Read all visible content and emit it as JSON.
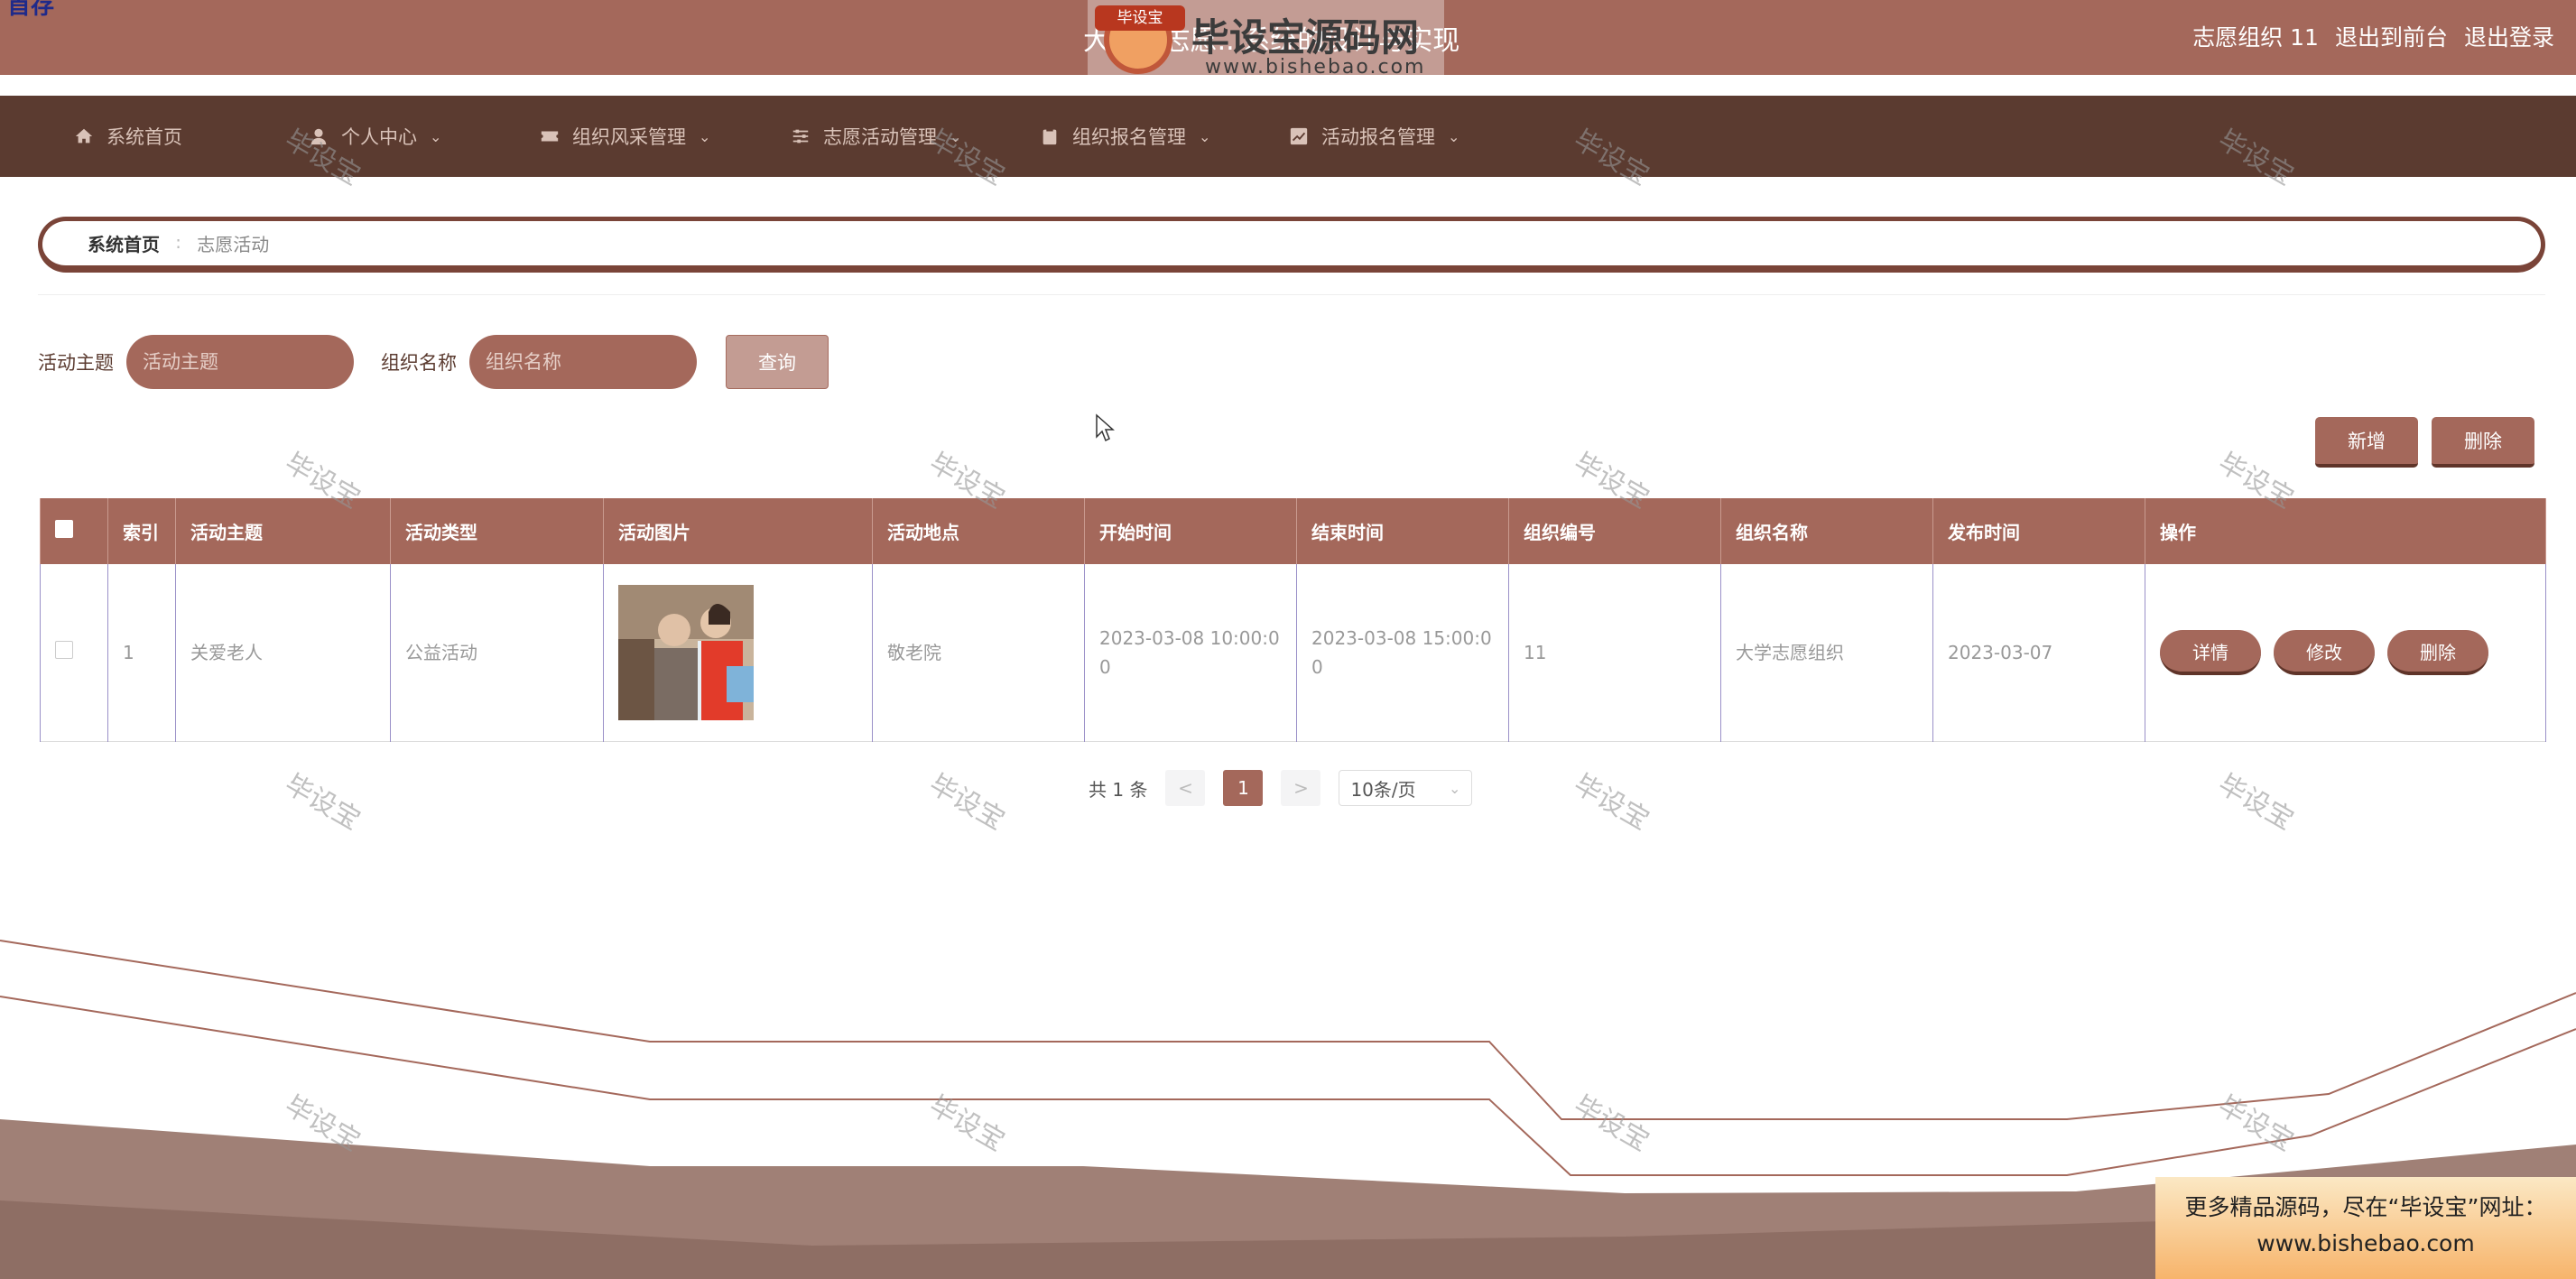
{
  "header": {
    "corner_text": "首存",
    "title": "大学...志愿...系统的设计与实现",
    "user_name": "志愿组织 11",
    "back_to_front": "退出到前台",
    "logout": "退出登录"
  },
  "logo_watermark": {
    "badge": "毕设宝",
    "brand": "毕设宝源码网",
    "url": "www.bishebao.com"
  },
  "nav": {
    "items": [
      {
        "label": "系统首页",
        "icon": "home-icon"
      },
      {
        "label": "个人中心",
        "icon": "user-icon"
      },
      {
        "label": "组织风采管理",
        "icon": "ticket-icon"
      },
      {
        "label": "志愿活动管理",
        "icon": "sliders-icon"
      },
      {
        "label": "组织报名管理",
        "icon": "clipboard-icon"
      },
      {
        "label": "活动报名管理",
        "icon": "chart-icon"
      }
    ]
  },
  "breadcrumb": {
    "home": "系统首页",
    "separator": "∶",
    "current": "志愿活动"
  },
  "search": {
    "topic_label": "活动主题",
    "topic_placeholder": "活动主题",
    "org_label": "组织名称",
    "org_placeholder": "组织名称",
    "query_button": "查询"
  },
  "actions": {
    "add": "新增",
    "delete": "删除"
  },
  "table": {
    "columns": [
      "索引",
      "活动主题",
      "活动类型",
      "活动图片",
      "活动地点",
      "开始时间",
      "结束时间",
      "组织编号",
      "组织名称",
      "发布时间",
      "操作"
    ],
    "rows": [
      {
        "index": "1",
        "topic": "关爱老人",
        "type": "公益活动",
        "location": "敬老院",
        "start": "2023-03-08 10:00:00",
        "end": "2023-03-08 15:00:00",
        "org_id": "11",
        "org_name": "大学志愿组织",
        "published": "2023-03-07",
        "ops": {
          "detail": "详情",
          "edit": "修改",
          "delete": "删除"
        }
      }
    ]
  },
  "pagination": {
    "total": "共 1 条",
    "prev": "<",
    "page": "1",
    "next": ">",
    "page_size": "10条/页"
  },
  "watermark_text": "毕设宝",
  "ad_banner": {
    "line1": "更多精品源码，尽在“毕设宝”网址：",
    "line2": "www.bishebao.com"
  },
  "colors": {
    "primary": "#a4685b",
    "nav_bg": "#5b3b30",
    "button_shadow": "#5f3429"
  }
}
